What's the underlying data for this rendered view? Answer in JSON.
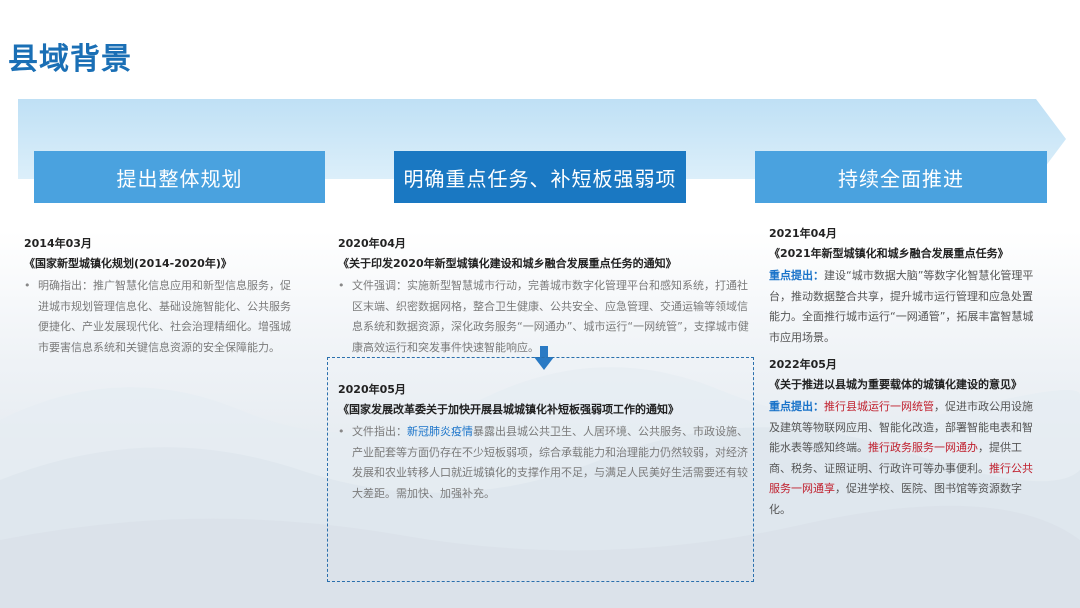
{
  "page": {
    "title": "县域背景"
  },
  "stages": [
    {
      "label": "提出整体规划"
    },
    {
      "label": "明确重点任务、补短板强弱项"
    },
    {
      "label": "持续全面推进"
    }
  ],
  "col1": {
    "date": "2014年03月",
    "doc": "《国家新型城镇化规划(2014-2020年)》",
    "text": "明确指出：推广智慧化信息应用和新型信息服务，促进城市规划管理信息化、基础设施智能化、公共服务便捷化、产业发展现代化、社会治理精细化。增强城市要害信息系统和关键信息资源的安全保障能力。"
  },
  "col2a": {
    "date": "2020年04月",
    "doc": "《关于印发2020年新型城镇化建设和城乡融合发展重点任务的通知》",
    "text": "文件强调：实施新型智慧城市行动，完善城市数字化管理平台和感知系统，打通社区末端、织密数据网格，整合卫生健康、公共安全、应急管理、交通运输等领域信息系统和数据资源，深化政务服务“一网通办”、城市运行“一网统管”，支撑城市健康高效运行和突发事件快速智能响应。"
  },
  "col2b": {
    "date": "2020年05月",
    "doc": "《国家发展改革委关于加快开展县城城镇化补短板强弱项工作的通知》",
    "lead": "文件指出：",
    "highlight": "新冠肺炎疫情",
    "text": "暴露出县城公共卫生、人居环境、公共服务、市政设施、产业配套等方面仍存在不少短板弱项，综合承载能力和治理能力仍然较弱，对经济发展和农业转移人口就近城镇化的支撑作用不足，与满足人民美好生活需要还有较大差距。需加快、加强补充。"
  },
  "col3a": {
    "date": "2021年04月",
    "doc": "《2021年新型城镇化和城乡融合发展重点任务》",
    "label": "重点提出：",
    "text": "建设“城市数据大脑”等数字化智慧化管理平台，推动数据整合共享，提升城市运行管理和应急处置能力。全面推行城市运行“一网通管”，拓展丰富智慧城市应用场景。"
  },
  "col3b": {
    "date": "2022年05月",
    "doc": "《关于推进以县城为重要载体的城镇化建设的意见》",
    "label": "重点提出：",
    "hl1": "推行县城运行一网统管",
    "t1": "，促进市政公用设施及建筑等物联网应用、智能化改造，部署智能电表和智能水表等感知终端。",
    "hl2": "推行政务服务一网通办",
    "t2": "，提供工商、税务、证照证明、行政许可等办事便利。",
    "hl3": "推行公共服务一网通享",
    "t3": "，促进学校、医院、图书馆等资源数字化。"
  },
  "colors": {
    "title": "#1a6fb5",
    "stage_light": "#4aa2df",
    "stage_dark": "#1a78c2",
    "highlight_blue": "#1a73c9",
    "highlight_red": "#c0202e"
  }
}
